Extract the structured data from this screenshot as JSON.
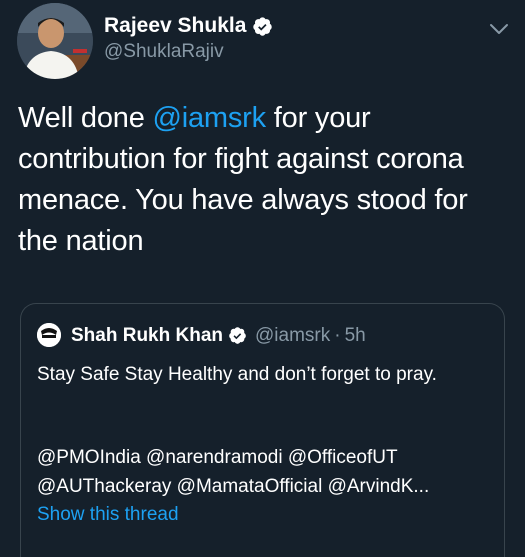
{
  "tweet": {
    "author": {
      "name": "Rajeev Shukla",
      "handle": "@ShuklaRajiv",
      "verified": true
    },
    "text_before": "Well done ",
    "mention": "@iamsrk",
    "text_after": " for your contribution for fight against corona menace. You have always stood for the nation"
  },
  "quote": {
    "author": {
      "name": "Shah Rukh Khan",
      "handle": "@iamsrk",
      "verified": true
    },
    "separator": "·",
    "time": "5h",
    "text": "Stay Safe Stay Healthy and don’t forget to pray.",
    "mentions_line1": "@PMOIndia @narendramodi @OfficeofUT",
    "mentions_line2": "@AUThackeray @MamataOfficial @ArvindK...",
    "show_thread": "Show this thread"
  },
  "icons": {
    "verified": "verified-badge-icon",
    "caret": "chevron-down-icon"
  },
  "colors": {
    "background": "#15202b",
    "accent": "#1da1f2",
    "secondary_text": "#8899a6",
    "border": "#38444d"
  }
}
